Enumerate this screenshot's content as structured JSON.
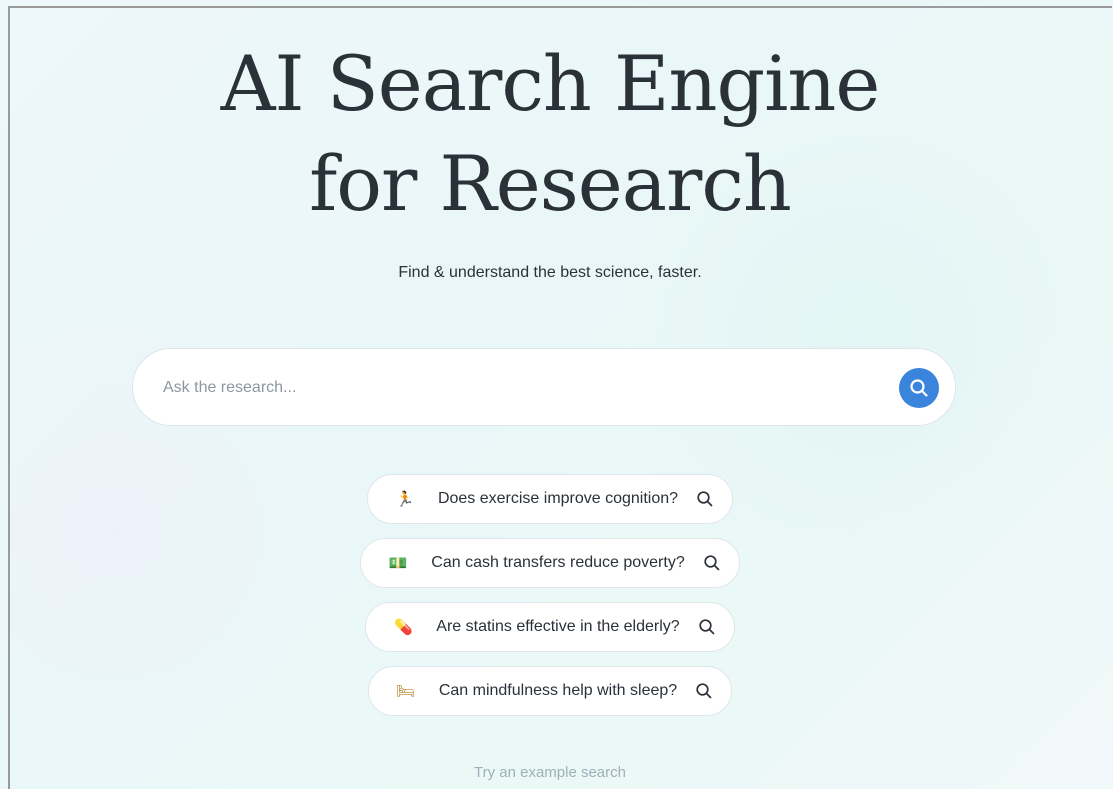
{
  "hero": {
    "title_line1": "AI Search Engine",
    "title_line2": "for Research",
    "subtitle": "Find & understand the best science, faster."
  },
  "search": {
    "placeholder": "Ask the research...",
    "value": "",
    "submit_icon": "search-icon",
    "accent_color": "#3a84dc"
  },
  "examples": [
    {
      "emoji": "🏃",
      "icon_name": "running-person-icon",
      "text": "Does exercise improve cognition?"
    },
    {
      "emoji": "💵",
      "icon_name": "cash-icon",
      "text": "Can cash transfers reduce poverty?"
    },
    {
      "emoji": "💊",
      "icon_name": "pill-icon",
      "text": "Are statins effective in the elderly?"
    },
    {
      "emoji": "🛏",
      "icon_name": "bed-icon",
      "text": "Can mindfulness help with sleep?"
    }
  ],
  "footer": {
    "try_label": "Try an example search"
  }
}
